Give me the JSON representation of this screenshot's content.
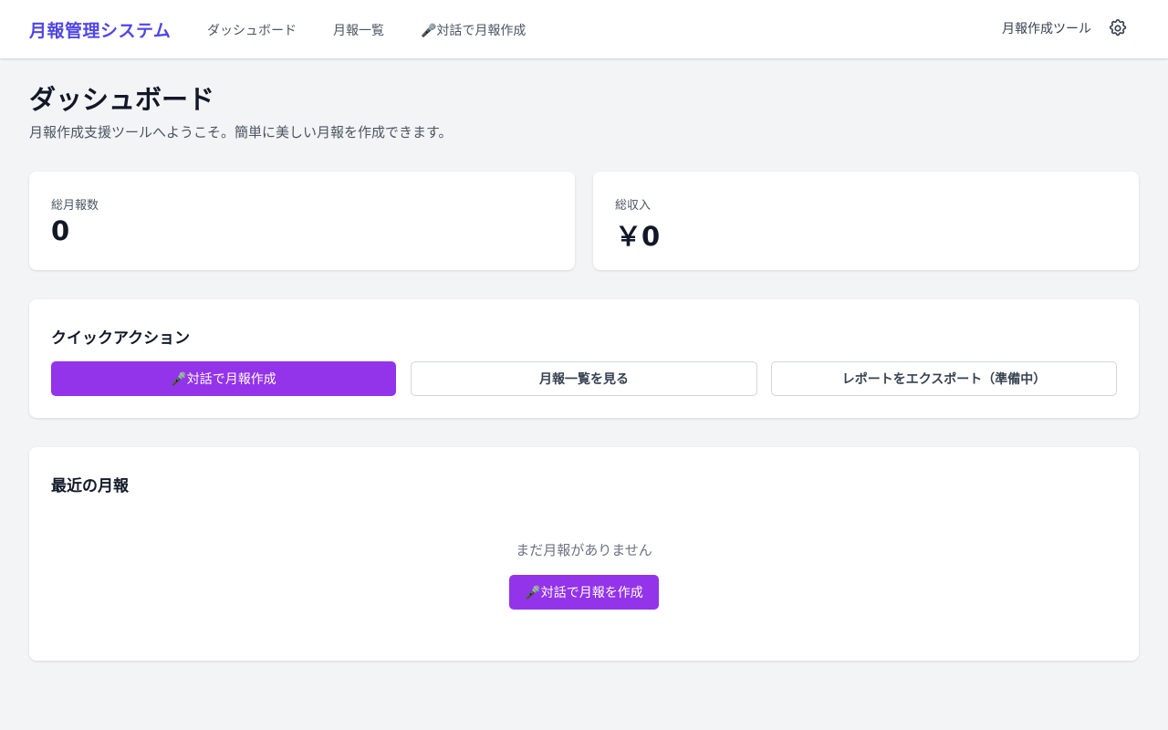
{
  "header": {
    "brand": "月報管理システム",
    "nav": [
      "ダッシュボード",
      "月報一覧",
      "🎤対話で月報作成"
    ],
    "tool_label": "月報作成ツール",
    "settings_icon": "gear-icon"
  },
  "page": {
    "title": "ダッシュボード",
    "subtitle": "月報作成支援ツールへようこそ。簡単に美しい月報を作成できます。"
  },
  "stats": [
    {
      "label": "総月報数",
      "value": "0"
    },
    {
      "label": "総収入",
      "value": "￥0"
    }
  ],
  "quick_actions": {
    "title": "クイックアクション",
    "buttons": [
      "🎤対話で月報作成",
      "月報一覧を見る",
      "レポートをエクスポート（準備中）"
    ]
  },
  "recent": {
    "title": "最近の月報",
    "empty_text": "まだ月報がありません",
    "cta_label": "🎤対話で月報を作成"
  },
  "colors": {
    "brand": "#4f46e5",
    "primary_button": "#9333ea",
    "background": "#f3f4f6"
  }
}
